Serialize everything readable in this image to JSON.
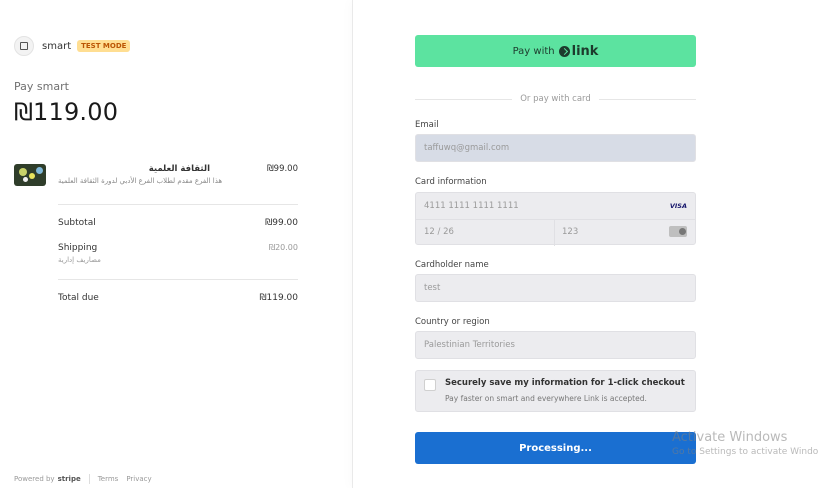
{
  "merchant": {
    "name": "smart",
    "badge": "TEST MODE",
    "pay_label": "Pay smart",
    "total_amount": "₪119.00"
  },
  "product": {
    "name": "الثقافة العلمية",
    "description": "هذا الفرع مقدم لطلاب الفرع الأدبي لدورة الثقافة العلمية",
    "price": "₪99.00"
  },
  "summary": {
    "subtotal_label": "Subtotal",
    "subtotal_value": "₪99.00",
    "shipping_label": "Shipping",
    "shipping_sub": "مصاريف إدارية",
    "shipping_value": "₪20.00",
    "total_label": "Total due",
    "total_value": "₪119.00"
  },
  "footer": {
    "powered_by": "Powered by",
    "stripe": "stripe",
    "terms": "Terms",
    "privacy": "Privacy"
  },
  "checkout": {
    "link_button_prefix": "Pay with",
    "link_button_brand": "link",
    "or_text": "Or pay with card",
    "email_label": "Email",
    "email_value": "taffuwq@gmail.com",
    "card_label": "Card information",
    "card_number": "4111 1111 1111 1111",
    "card_brand": "VISA",
    "card_expiry": "12 / 26",
    "card_cvc": "123",
    "cardholder_label": "Cardholder name",
    "cardholder_value": "test",
    "country_label": "Country or region",
    "country_value": "Palestinian Territories",
    "save_title": "Securely save my information for 1-click checkout",
    "save_sub": "Pay faster on smart and everywhere Link is accepted.",
    "submit_label": "Processing..."
  },
  "watermark": {
    "title": "Activate Windows",
    "subtitle": "Go to Settings to activate Windo"
  },
  "colors": {
    "link_green": "#5ce3a0",
    "primary_blue": "#1a6fd1",
    "badge_bg": "#ffde92",
    "badge_text": "#bb5504"
  }
}
